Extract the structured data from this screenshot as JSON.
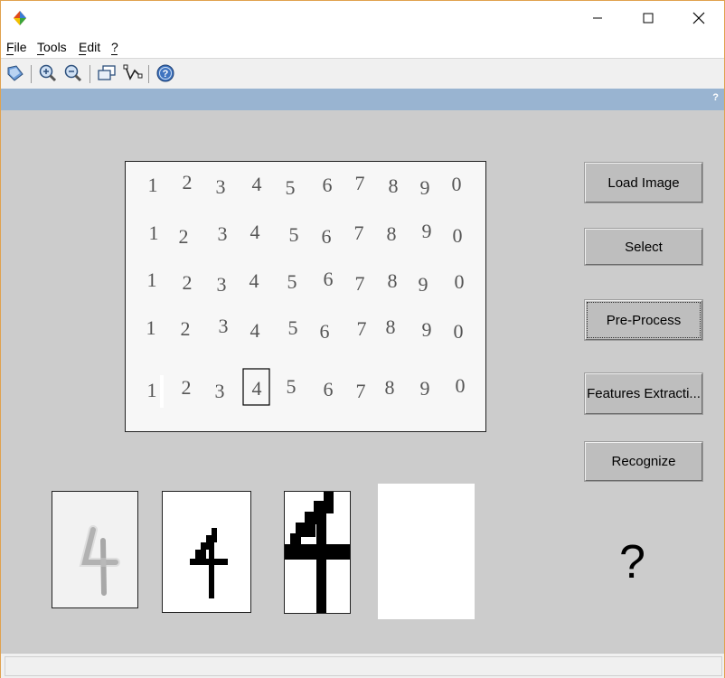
{
  "window": {
    "title_controls": {
      "minimize": "—",
      "maximize": "☐",
      "close": "✕"
    }
  },
  "menu": {
    "items": [
      "File",
      "Tools",
      "Edit",
      "?"
    ]
  },
  "toolbar": {
    "icons": [
      "edit-plot-icon",
      "zoom-in-icon",
      "zoom-out-icon",
      "pan-icon",
      "data-cursor-icon",
      "help-icon"
    ]
  },
  "strip": {
    "help_glyph": "?"
  },
  "digit_grid": {
    "rows": [
      [
        "1",
        "2",
        "3",
        "4",
        "5",
        "6",
        "7",
        "8",
        "9",
        "0"
      ],
      [
        "1",
        "2",
        "3",
        "4",
        "5",
        "6",
        "7",
        "8",
        "9",
        "0"
      ],
      [
        "1",
        "2",
        "3",
        "4",
        "5",
        "6",
        "7",
        "8",
        "9",
        "0"
      ],
      [
        "1",
        "2",
        "3",
        "4",
        "5",
        "6",
        "7",
        "8",
        "9",
        "0"
      ],
      [
        "1",
        "2",
        "3",
        "4",
        "5",
        "6",
        "7",
        "8",
        "9",
        "0"
      ]
    ],
    "selected": {
      "row": 4,
      "col": 3
    }
  },
  "buttons": {
    "load": "Load Image",
    "select": "Select",
    "preprocess": "Pre-Process",
    "features": "Features Extracti...",
    "recognize": "Recognize"
  },
  "result": {
    "text": "?"
  },
  "colors": {
    "figure_bg": "#cccccc",
    "strip": "#99b4d1",
    "button": "#bebebe"
  }
}
